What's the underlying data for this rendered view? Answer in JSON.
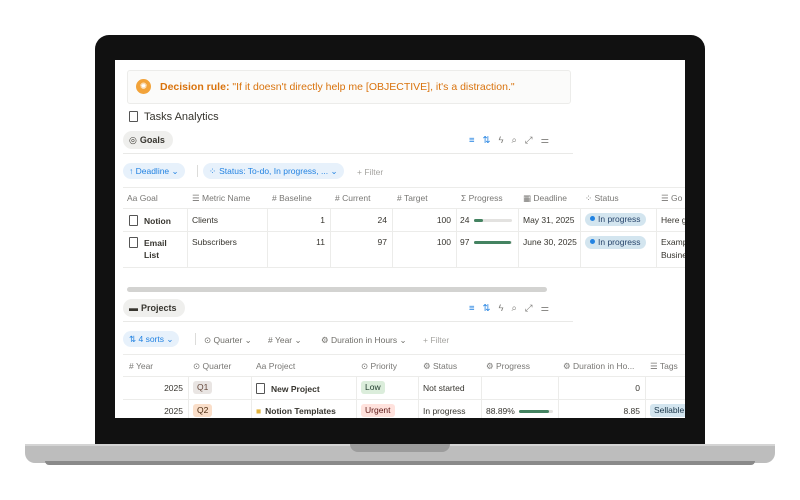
{
  "callout": {
    "icon": "brain-emoji-icon",
    "label": "Decision rule:",
    "text": "\"If it doesn't directly help me [OBJECTIVE], it's a distraction.\""
  },
  "page_title": "Tasks Analytics",
  "goals": {
    "tab_label": "Goals",
    "filters": {
      "deadline_chip": "↑ Deadline ⌄",
      "status_chip": "Status: To-do, In progress, ... ⌄",
      "add_filter": "+ Filter"
    },
    "columns": [
      "Goal",
      "Metric Name",
      "Baseline",
      "Current",
      "Target",
      "Progress",
      "Deadline",
      "Status",
      "Go"
    ],
    "rows": [
      {
        "goal": "Notion",
        "metric": "Clients",
        "baseline": "1",
        "current": "24",
        "target": "100",
        "progress_label": "24",
        "progress": 0.24,
        "deadline": "May 31, 2025",
        "status": "In progress",
        "notes": "Here g"
      },
      {
        "goal_line1": "Email",
        "goal_line2": "List",
        "metric": "Subscribers",
        "baseline": "11",
        "current": "97",
        "target": "100",
        "progress_label": "97",
        "progress": 0.97,
        "deadline": "June 30, 2025",
        "status": "In progress",
        "notes_line1": "Examp",
        "notes_line2": "Busine"
      }
    ]
  },
  "projects": {
    "tab_label": "Projects",
    "filters": {
      "sorts_chip": "⇅ 4 sorts ⌄",
      "quarter": "Quarter ⌄",
      "year": "Year ⌄",
      "duration": "Duration in Hours ⌄",
      "add_filter": "+ Filter"
    },
    "columns": [
      "Year",
      "Quarter",
      "Project",
      "Priority",
      "Status",
      "Progress",
      "Duration in Ho...",
      "Tags"
    ],
    "rows": [
      {
        "year": "2025",
        "quarter": "Q1",
        "project": "New Project",
        "priority": "Low",
        "status": "Not started",
        "progress_label": "",
        "progress": 0,
        "duration": "0",
        "tag": ""
      },
      {
        "year": "2025",
        "quarter": "Q2",
        "project": "Notion Templates",
        "priority": "Urgent",
        "status": "In progress",
        "progress_label": "88.89%",
        "progress": 0.8889,
        "duration": "8.85",
        "tag": "Sellable"
      }
    ]
  },
  "colors": {
    "accent": "#2383e2",
    "progress_green": "#448361",
    "callout_orange": "#d9730d"
  }
}
